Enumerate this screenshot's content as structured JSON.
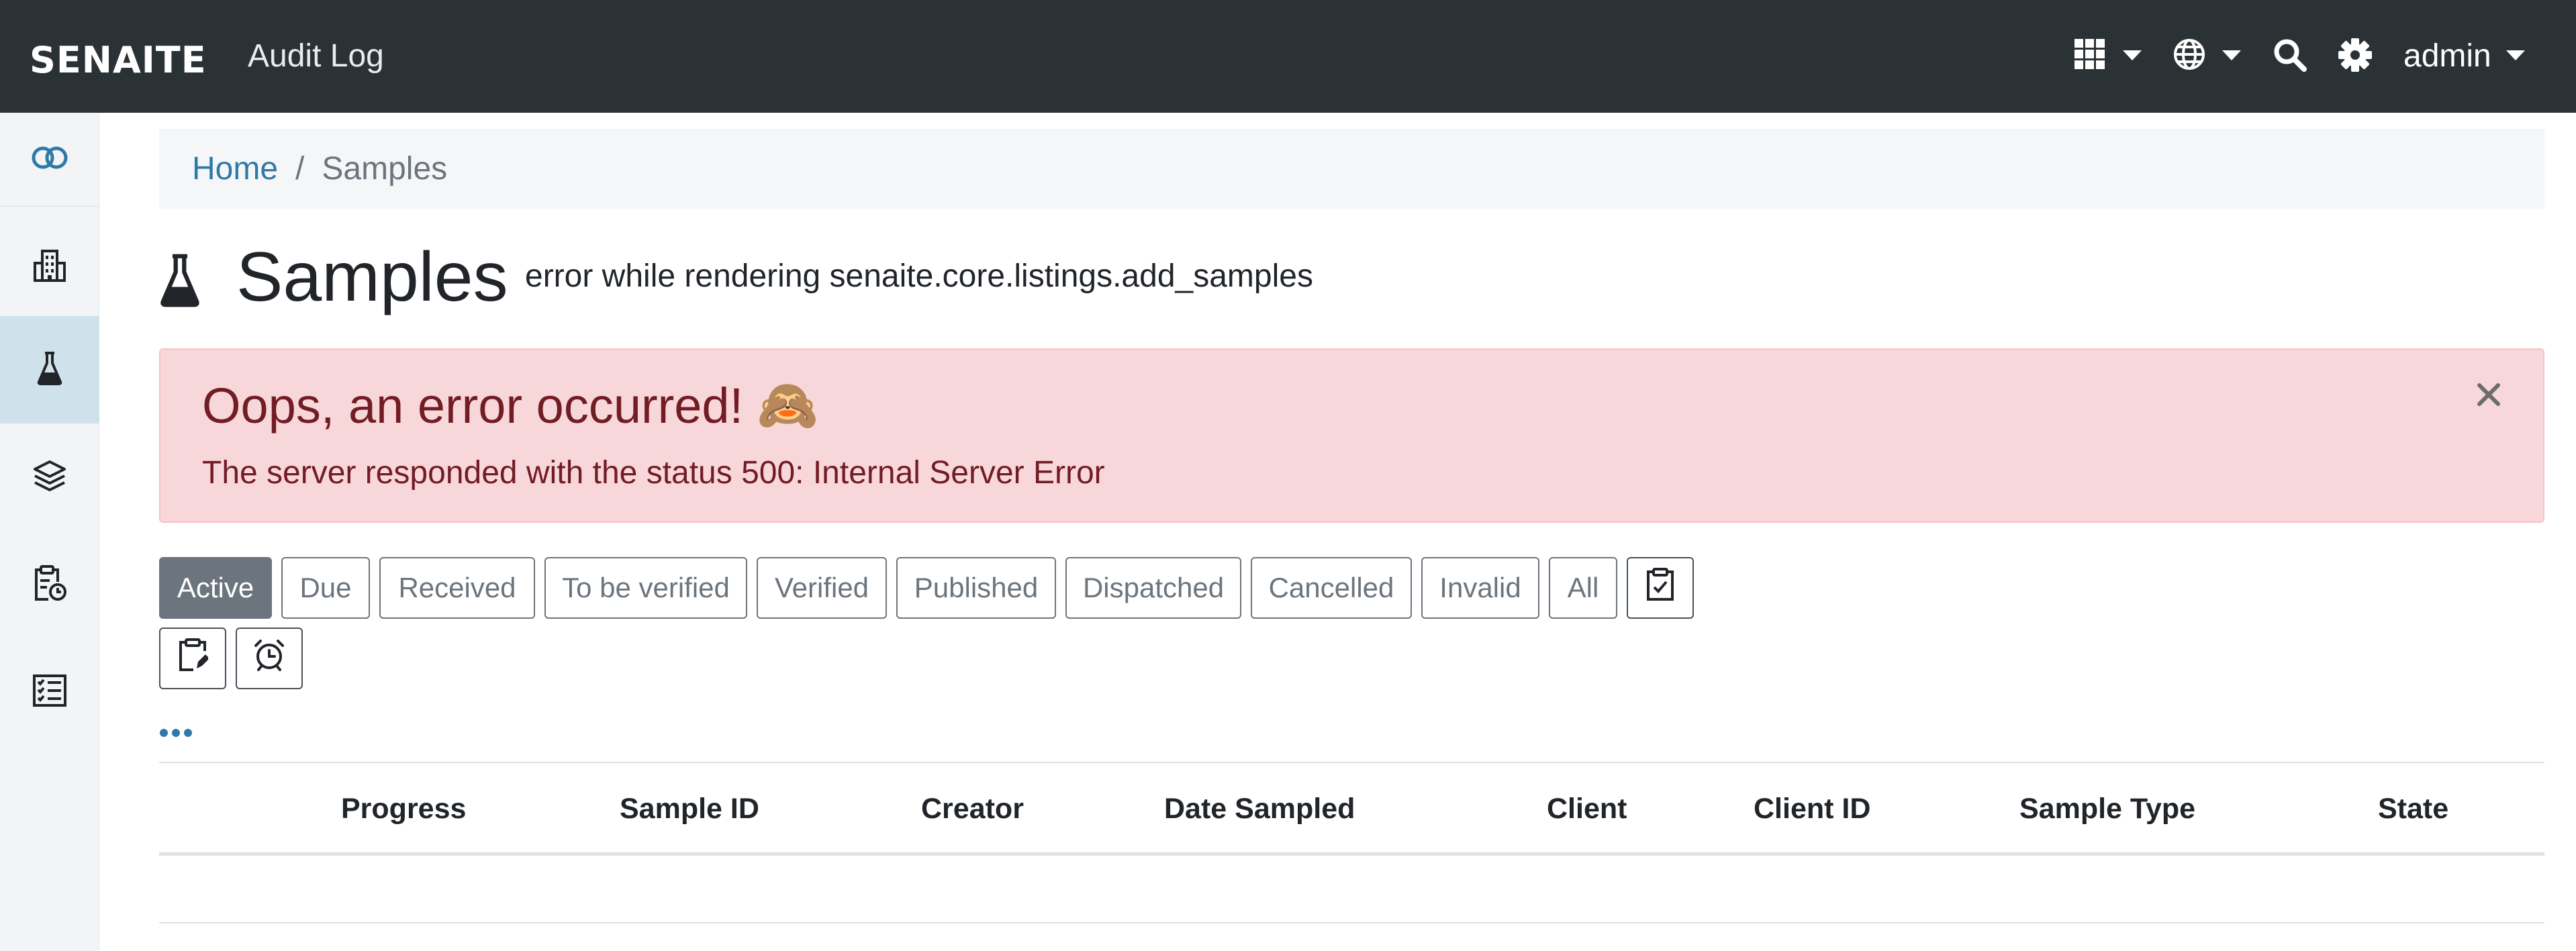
{
  "navbar": {
    "logo": "SENAITE",
    "title": "Audit Log",
    "user": "admin",
    "icons": [
      "grid-icon",
      "globe-icon",
      "search-icon",
      "gear-icon"
    ]
  },
  "sidebar": {
    "items": [
      {
        "icon": "toggle-icon",
        "active": false
      },
      {
        "icon": "building-icon",
        "active": false
      },
      {
        "icon": "flask-icon",
        "active": true
      },
      {
        "icon": "layers-icon",
        "active": false
      },
      {
        "icon": "clipboard-clock-icon",
        "active": false
      },
      {
        "icon": "checklist-icon",
        "active": false
      }
    ]
  },
  "breadcrumb": {
    "home": "Home",
    "separator": "/",
    "current": "Samples"
  },
  "page": {
    "title": "Samples",
    "error_text": "error while rendering senaite.core.listings.add_samples"
  },
  "alert": {
    "heading": "Oops, an error occurred!",
    "emoji": "🙈",
    "message": "The server responded with the status 500: Internal Server Error",
    "close": "×"
  },
  "filters": {
    "buttons": [
      "Active",
      "Due",
      "Received",
      "To be verified",
      "Verified",
      "Published",
      "Dispatched",
      "Cancelled",
      "Invalid",
      "All"
    ],
    "active": "Active",
    "icon_buttons": [
      "clipboard-check-icon",
      "clipboard-edit-icon",
      "alarm-clock-icon"
    ]
  },
  "more": "•••",
  "table": {
    "columns": [
      "Progress",
      "Sample ID",
      "Creator",
      "Date Sampled",
      "Client",
      "Client ID",
      "Sample Type",
      "State"
    ],
    "rows": []
  },
  "colors": {
    "navbar_bg": "#2b3236",
    "accent_link": "#2f79a6",
    "alert_bg": "#f8d7da",
    "alert_text": "#721c24",
    "active_filter": "#6c757d",
    "sidebar_active": "#cfe2ec"
  }
}
